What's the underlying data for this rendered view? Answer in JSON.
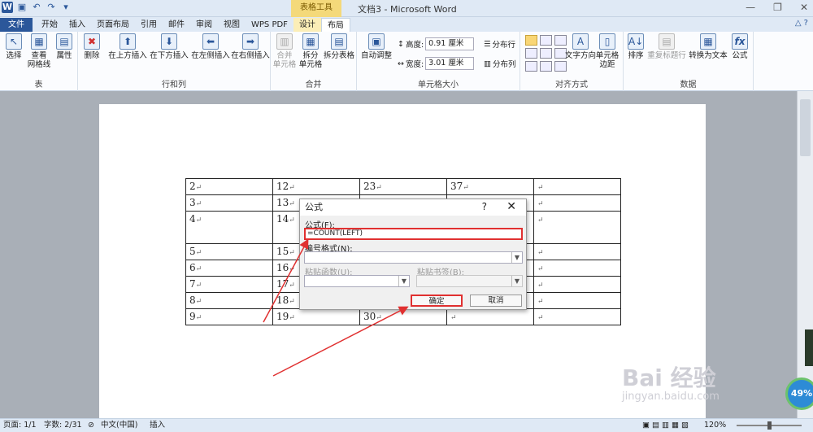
{
  "title_bar": {
    "context_group": "表格工具",
    "document_title": "文档3 - Microsoft Word"
  },
  "tabs": [
    {
      "label": "文件"
    },
    {
      "label": "开始"
    },
    {
      "label": "插入"
    },
    {
      "label": "页面布局"
    },
    {
      "label": "引用"
    },
    {
      "label": "邮件"
    },
    {
      "label": "审阅"
    },
    {
      "label": "视图"
    },
    {
      "label": "WPS PDF"
    },
    {
      "label": "设计"
    },
    {
      "label": "布局"
    }
  ],
  "ribbon": {
    "groups": {
      "table": "表",
      "rows_cols": "行和列",
      "merge": "合并",
      "cell_size": "单元格大小",
      "alignment": "对齐方式",
      "data": "数据"
    },
    "buttons": {
      "select": "选择",
      "view_gridlines": "查看\n网格线",
      "properties": "属性",
      "delete": "删除",
      "insert_above": "在上方插入",
      "insert_below": "在下方插入",
      "insert_left": "在左侧插入",
      "insert_right": "在右侧插入",
      "merge_cells": "合并\n单元格",
      "split_cells": "拆分\n单元格",
      "split_table": "拆分表格",
      "autofit": "自动调整",
      "distribute_rows": "分布行",
      "distribute_cols": "分布列",
      "text_direction": "文字方向",
      "cell_margins": "单元格\n边距",
      "sort": "排序",
      "repeat_header": "重复标题行",
      "convert_text": "转换为文本",
      "formula": "公式"
    },
    "height_label": "高度:",
    "height_value": "0.91 厘米",
    "width_label": "宽度:",
    "width_value": "3.01 厘米"
  },
  "table": {
    "rows": [
      [
        "2",
        "12",
        "23",
        "37",
        ""
      ],
      [
        "3",
        "13",
        "",
        "",
        ""
      ],
      [
        "4",
        "14",
        "",
        "",
        ""
      ],
      [
        "5",
        "15",
        "",
        "",
        ""
      ],
      [
        "6",
        "16",
        "",
        "",
        ""
      ],
      [
        "7",
        "17",
        "",
        "",
        ""
      ],
      [
        "8",
        "18",
        "",
        "",
        ""
      ],
      [
        "9",
        "19",
        "30",
        "",
        ""
      ]
    ]
  },
  "dialog": {
    "title": "公式",
    "help": "?",
    "formula_label": "公式(F):",
    "formula_value": "=COUNT(LEFT)",
    "number_format_label": "编号格式(N):",
    "paste_function_label": "粘贴函数(U):",
    "paste_bookmark_label": "粘贴书签(B):",
    "ok": "确定",
    "cancel": "取消"
  },
  "watermark": {
    "text": "Bai 经验",
    "url": "jingyan.baidu.com"
  },
  "badge": "49%",
  "status_bar": {
    "page": "页面: 1/1",
    "words": "字数: 2/31",
    "language": "中文(中国)",
    "mode": "插入",
    "zoom": "120%"
  }
}
